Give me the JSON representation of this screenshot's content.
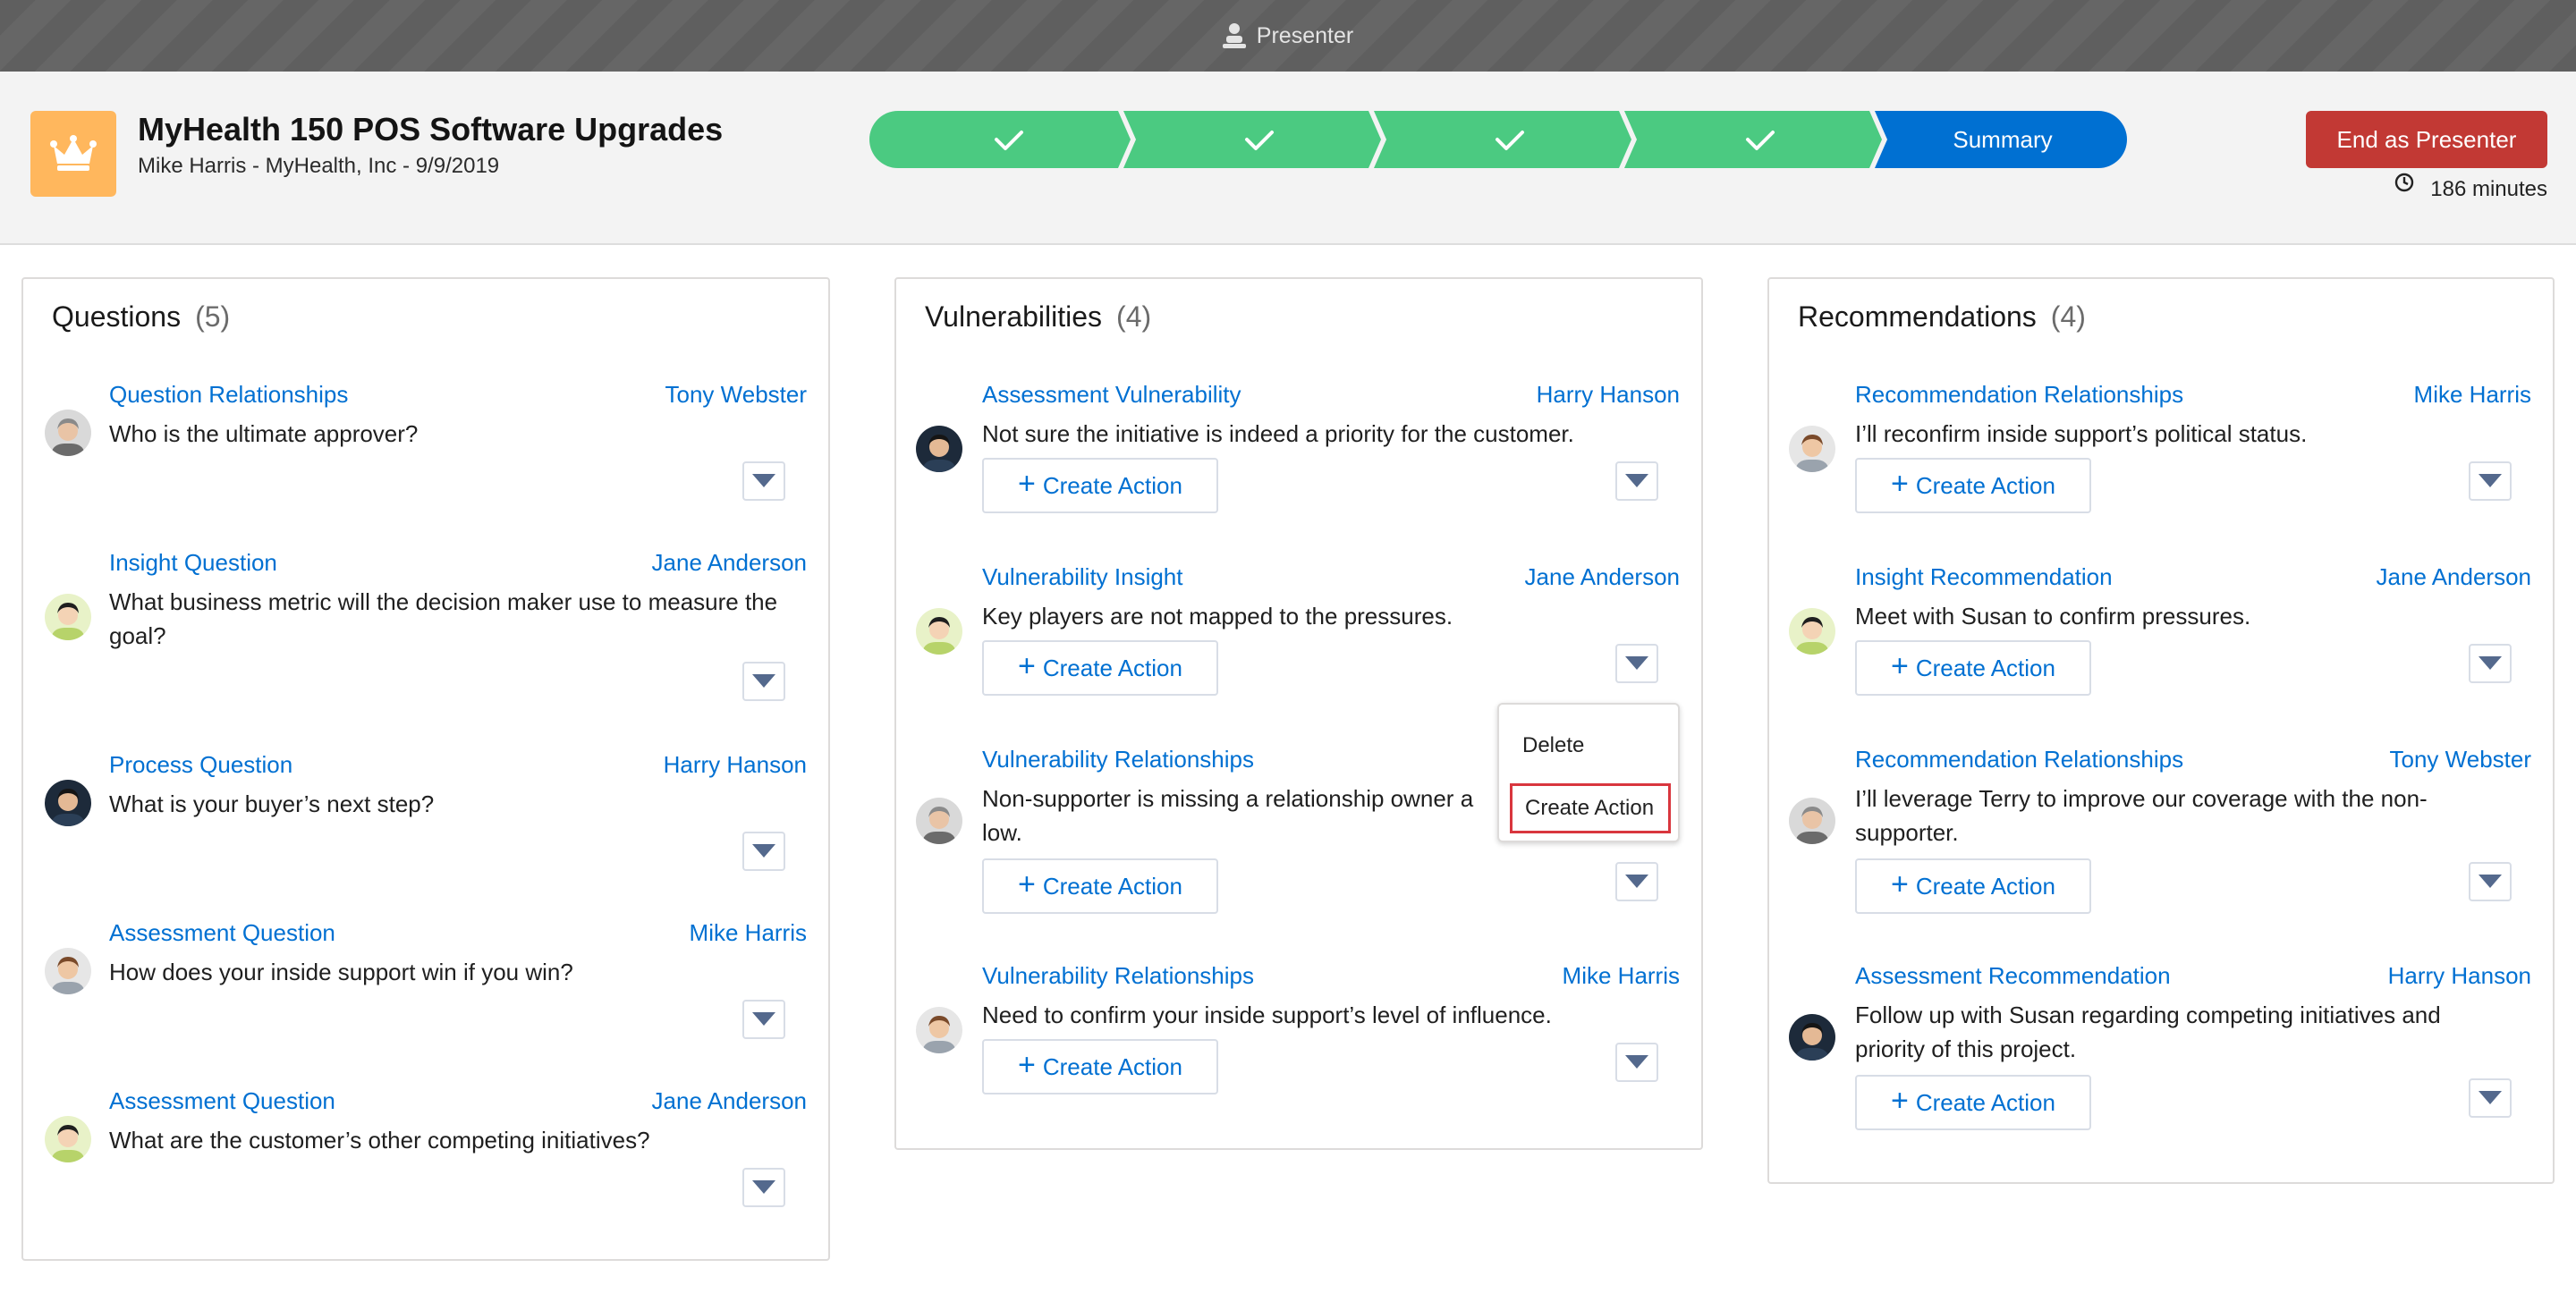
{
  "topbar": {
    "label": "Presenter"
  },
  "header": {
    "title": "MyHealth 150 POS Software Upgrades",
    "subtitle": "Mike Harris - MyHealth, Inc - 9/9/2019",
    "path": {
      "steps": [
        "complete",
        "complete",
        "complete",
        "complete",
        "current"
      ],
      "current_label": "Summary",
      "complete_color": "#4bca81",
      "current_color": "#0070d2"
    },
    "end_button": "End as Presenter",
    "timer": "186 minutes"
  },
  "questions": {
    "title": "Questions",
    "count": "(5)",
    "items": [
      {
        "type": "Question Relationships",
        "owner": "Tony Webster",
        "text": "Who is the ultimate approver?",
        "avatar": "tony"
      },
      {
        "type": "Insight Question",
        "owner": "Jane Anderson",
        "text": "What business metric will the decision maker use to measure the goal?",
        "avatar": "jane"
      },
      {
        "type": "Process Question",
        "owner": "Harry Hanson",
        "text": "What is your buyer’s next step?",
        "avatar": "harry"
      },
      {
        "type": "Assessment Question",
        "owner": "Mike Harris",
        "text": "How does your inside support win if you win?",
        "avatar": "mike"
      },
      {
        "type": "Assessment Question",
        "owner": "Jane Anderson",
        "text": "What are the customer’s other competing initiatives?",
        "avatar": "jane"
      }
    ]
  },
  "vulnerabilities": {
    "title": "Vulnerabilities",
    "count": "(4)",
    "create_label": "Create Action",
    "items": [
      {
        "type": "Assessment Vulnerability",
        "owner": "Harry Hanson",
        "text": "Not sure the initiative is indeed a priority for the customer.",
        "avatar": "harry"
      },
      {
        "type": "Vulnerability Insight",
        "owner": "Jane Anderson",
        "text": "Key players are not mapped to the pressures.",
        "avatar": "jane"
      },
      {
        "type": "Vulnerability Relationships",
        "owner": "",
        "text": "Non-supporter is missing a relationship owner a",
        "text2": "low.",
        "avatar": "tony"
      },
      {
        "type": "Vulnerability Relationships",
        "owner": "Mike Harris",
        "text": "Need to confirm your inside support’s level of influence.",
        "avatar": "mike"
      }
    ]
  },
  "recommendations": {
    "title": "Recommendations",
    "count": "(4)",
    "create_label": "Create Action",
    "items": [
      {
        "type": "Recommendation Relationships",
        "owner": "Mike Harris",
        "text": "I’ll reconfirm inside support’s political status.",
        "avatar": "mike"
      },
      {
        "type": "Insight Recommendation",
        "owner": "Jane Anderson",
        "text": "Meet with Susan to confirm pressures.",
        "avatar": "jane"
      },
      {
        "type": "Recommendation Relationships",
        "owner": "Tony Webster",
        "text": "I’ll leverage Terry to improve our coverage with the non-supporter.",
        "avatar": "tony"
      },
      {
        "type": "Assessment Recommendation",
        "owner": "Harry Hanson",
        "text": "Follow up with Susan regarding competing initiatives and priority of this project.",
        "avatar": "harry"
      }
    ]
  },
  "dropdown_menu": {
    "delete": "Delete",
    "create_action": "Create Action"
  }
}
